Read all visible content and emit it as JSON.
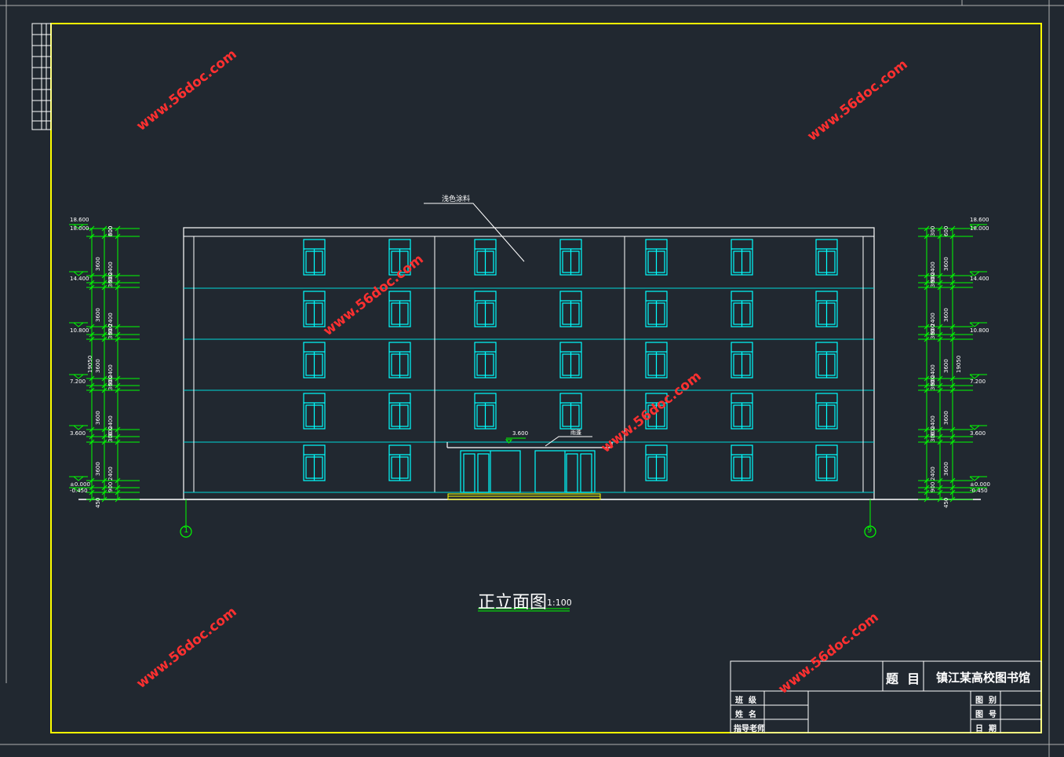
{
  "drawing": {
    "title": "正立面图",
    "scale": "1:100",
    "material_note": "浅色涂料",
    "canopy_label": "3.600",
    "canopy_note": "雨蓬",
    "axis_labels": [
      "1",
      "9"
    ],
    "watermark": "www.56doc.com"
  },
  "elevations_left": [
    "18.600",
    "18.000",
    "14.400",
    "10.800",
    "7.200",
    "3.600",
    "±0.000",
    "-0.450"
  ],
  "elevations_right": [
    "18.600",
    "18.000",
    "14.400",
    "10.800",
    "7.200",
    "3.600",
    "±0.000",
    "-0.450"
  ],
  "dims_inner": [
    "300",
    "2400",
    "900",
    "300",
    "2400",
    "900",
    "300",
    "2400",
    "900",
    "300",
    "2400",
    "900",
    "300",
    "2400",
    "900"
  ],
  "dims_outer": [
    "3600",
    "3600",
    "3600",
    "3600",
    "3600"
  ],
  "dims_total": "19050",
  "dims_extra": [
    "600",
    "450"
  ],
  "title_block": {
    "subject_label": "题  目",
    "subject_value": "镇江某高校图书馆",
    "rows_left": [
      "班  级",
      "姓  名",
      "指导老师"
    ],
    "rows_right": [
      "图  别",
      "图  号",
      "日  期"
    ]
  },
  "colors": {
    "background": "#212830",
    "frame": "#ffff00",
    "building": "#ffffff",
    "windows": "#00ffff",
    "dims": "#00ff00",
    "watermark": "#ff3030"
  }
}
